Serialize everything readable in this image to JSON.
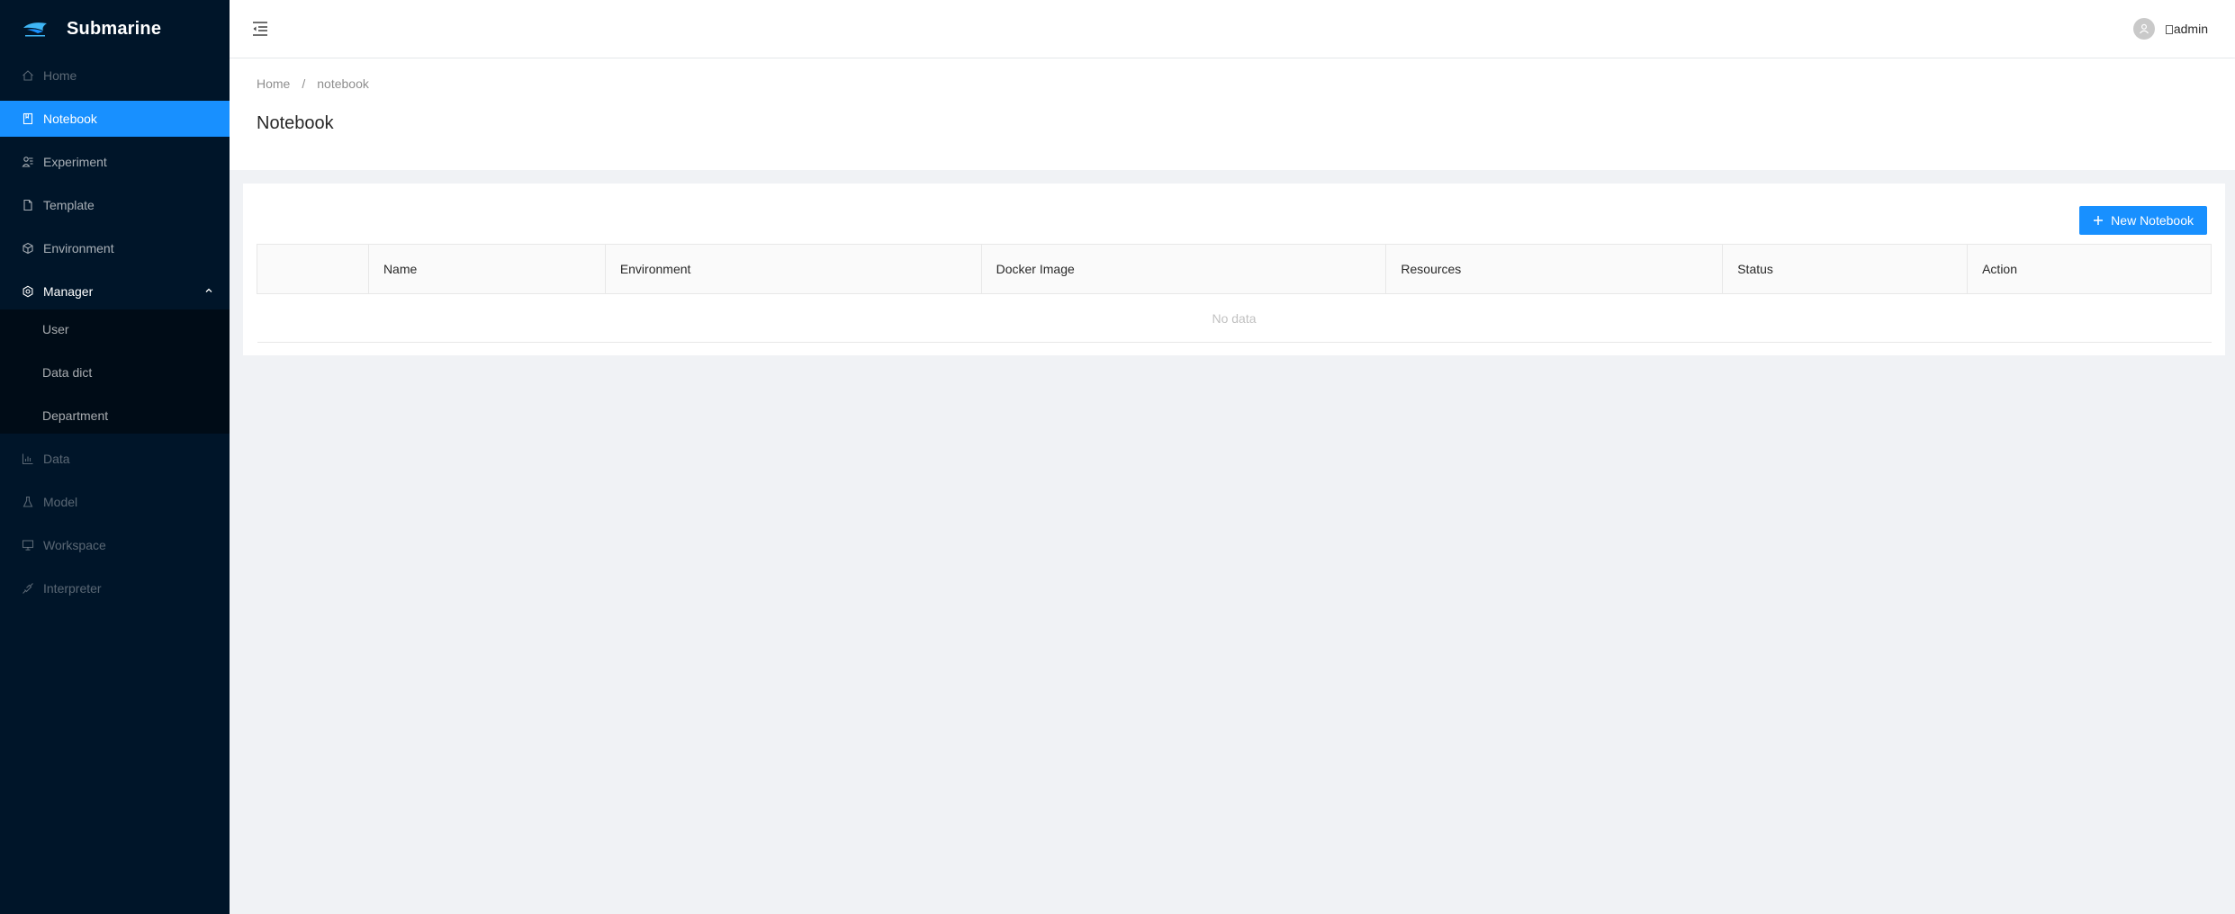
{
  "app": {
    "name": "Submarine"
  },
  "sidebar": {
    "items": [
      {
        "label": "Home",
        "icon": "home-icon",
        "state": "disabled"
      },
      {
        "label": "Notebook",
        "icon": "book-icon",
        "state": "selected"
      },
      {
        "label": "Experiment",
        "icon": "experiment-icon",
        "state": "normal"
      },
      {
        "label": "Template",
        "icon": "file-icon",
        "state": "normal"
      },
      {
        "label": "Environment",
        "icon": "codesandbox-icon",
        "state": "normal"
      },
      {
        "label": "Manager",
        "icon": "setting-icon",
        "state": "open",
        "children": [
          {
            "label": "User"
          },
          {
            "label": "Data dict"
          },
          {
            "label": "Department"
          }
        ]
      },
      {
        "label": "Data",
        "icon": "bar-chart-icon",
        "state": "disabled"
      },
      {
        "label": "Model",
        "icon": "flask-icon",
        "state": "disabled"
      },
      {
        "label": "Workspace",
        "icon": "desktop-icon",
        "state": "disabled"
      },
      {
        "label": "Interpreter",
        "icon": "api-icon",
        "state": "disabled"
      }
    ]
  },
  "header": {
    "username": "admin"
  },
  "breadcrumb": {
    "home": "Home",
    "separator": "/",
    "current": "notebook"
  },
  "page": {
    "title": "Notebook"
  },
  "toolbar": {
    "new_label": "New Notebook"
  },
  "table": {
    "columns": [
      "",
      "Name",
      "Environment",
      "Docker Image",
      "Resources",
      "Status",
      "Action"
    ],
    "empty_text": "No data"
  },
  "colors": {
    "primary": "#1890ff",
    "sidebar_bg": "#001529",
    "submenu_bg": "#000c17"
  }
}
